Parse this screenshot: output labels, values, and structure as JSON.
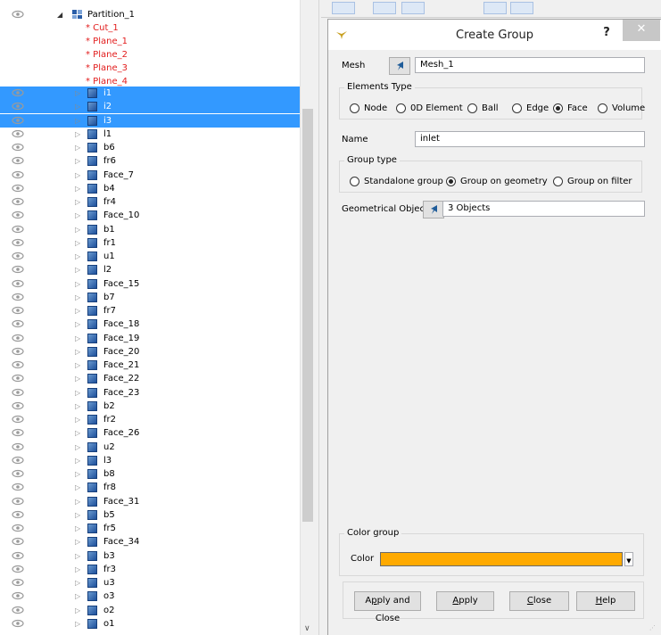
{
  "tree": {
    "root": "Partition_1",
    "sub_items": [
      "* Cut_1",
      "* Plane_1",
      "* Plane_2",
      "* Plane_3",
      "* Plane_4"
    ],
    "items": [
      {
        "label": "i1",
        "selected": true
      },
      {
        "label": "i2",
        "selected": true
      },
      {
        "label": "i3",
        "selected": true
      },
      {
        "label": "l1"
      },
      {
        "label": "b6"
      },
      {
        "label": "fr6"
      },
      {
        "label": "Face_7"
      },
      {
        "label": "b4"
      },
      {
        "label": "fr4"
      },
      {
        "label": "Face_10"
      },
      {
        "label": "b1"
      },
      {
        "label": "fr1"
      },
      {
        "label": "u1"
      },
      {
        "label": "l2"
      },
      {
        "label": "Face_15"
      },
      {
        "label": "b7"
      },
      {
        "label": "fr7"
      },
      {
        "label": "Face_18"
      },
      {
        "label": "Face_19"
      },
      {
        "label": "Face_20"
      },
      {
        "label": "Face_21"
      },
      {
        "label": "Face_22"
      },
      {
        "label": "Face_23"
      },
      {
        "label": "b2"
      },
      {
        "label": "fr2"
      },
      {
        "label": "Face_26"
      },
      {
        "label": "u2"
      },
      {
        "label": "l3"
      },
      {
        "label": "b8"
      },
      {
        "label": "fr8"
      },
      {
        "label": "Face_31"
      },
      {
        "label": "b5"
      },
      {
        "label": "fr5"
      },
      {
        "label": "Face_34"
      },
      {
        "label": "b3"
      },
      {
        "label": "fr3"
      },
      {
        "label": "u3"
      },
      {
        "label": "o3"
      },
      {
        "label": "o2"
      },
      {
        "label": "o1"
      }
    ],
    "icons": {
      "visibility": "eye-icon",
      "expander": "triangle-right-icon",
      "shape": "solid-cube-icon"
    }
  },
  "dialog": {
    "title": "Create Group",
    "help": "?",
    "close": "✕",
    "mesh": {
      "label": "Mesh",
      "value": "Mesh_1"
    },
    "elements_type": {
      "title": "Elements Type",
      "options": [
        "Node",
        "0D Element",
        "Ball",
        "Edge",
        "Face",
        "Volume"
      ],
      "selected": "Face"
    },
    "name": {
      "label": "Name",
      "value": "inlet"
    },
    "group_type": {
      "title": "Group type",
      "options": [
        "Standalone group",
        "Group on geometry",
        "Group on filter"
      ],
      "selected": "Group on geometry"
    },
    "geom": {
      "label": "Geometrical Object",
      "value": "3 Objects"
    },
    "color_group": {
      "title": "Color group",
      "label": "Color",
      "value": "#ffaa00"
    },
    "buttons": {
      "apply_close": {
        "pre": "A",
        "u": "p",
        "post": "ply and Close"
      },
      "apply": {
        "pre": "",
        "u": "A",
        "post": "pply"
      },
      "close": {
        "pre": "",
        "u": "C",
        "post": "lose"
      },
      "help": {
        "pre": "",
        "u": "H",
        "post": "elp"
      }
    }
  },
  "colors": {
    "selection": "#3399ff",
    "published_item": "#e21c1c",
    "accent_swatch": "#ffaa00"
  }
}
